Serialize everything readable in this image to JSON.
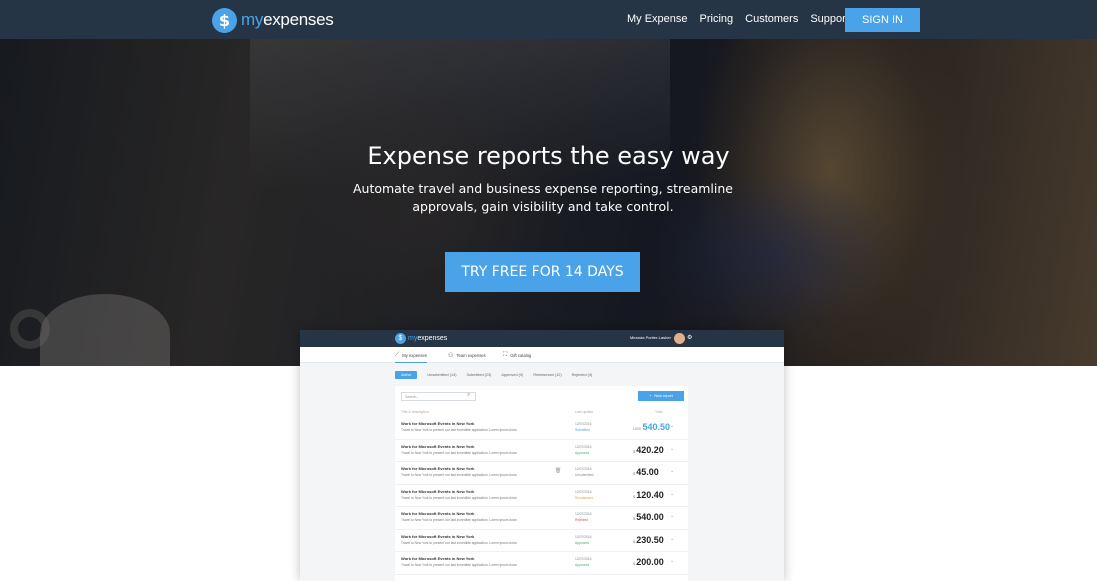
{
  "header": {
    "logo_my": "my",
    "logo_rest": "expenses",
    "logo_symbol": "$",
    "links": [
      "My Expense",
      "Pricing",
      "Customers",
      "Support"
    ],
    "signin_label": "SIGN IN"
  },
  "hero": {
    "title": "Expense reports the easy way",
    "subtitle": "Automate travel and business expense reporting, streamline approvals, gain visibility and take control.",
    "cta_label": "TRY FREE FOR 14 DAYS"
  },
  "colors": {
    "brand_dark": "#263545",
    "accent": "#4aa3e8",
    "approved": "#3cb371",
    "rejected": "#e05050",
    "submitted": "#4aa3e8",
    "unsubmitted": "#888888",
    "reimbursed": "#f0a030"
  },
  "preview": {
    "logo_my": "my",
    "logo_rest": "expenses",
    "user_name": "Miranda Portier-Lasher",
    "tabs": [
      {
        "icon": "chart-icon",
        "label": "My expenses"
      },
      {
        "icon": "team-icon",
        "label": "Team expenses"
      },
      {
        "icon": "gift-icon",
        "label": "Gift catalog"
      }
    ],
    "filters": [
      "Active",
      "Unsubmitted (14)",
      "Submitted (23)",
      "Approved (0)",
      "Reimbursed (12)",
      "Rejected (4)"
    ],
    "search_placeholder": "Search...",
    "new_report_label": "New report",
    "columns": {
      "title": "Title & description",
      "date": "Last update",
      "amount": "Total"
    },
    "rows": [
      {
        "title": "Work for Microsoft Events in New York",
        "desc": "Travel to New York to present our last incredible application. Lorem ipsum dolor.",
        "date": "12/07/2016",
        "status": "Submitted",
        "status_color": "#4aa3e8",
        "currency": "USD",
        "amount": "540.50",
        "highlight": true
      },
      {
        "title": "Work for Microsoft Events in New York",
        "desc": "Travel to New York to present our last incredible application. Lorem ipsum dolor.",
        "date": "12/07/2016",
        "status": "Approved",
        "status_color": "#3cb371",
        "currency": "$",
        "amount": "420.20",
        "highlight": false
      },
      {
        "title": "Work for Microsoft Events in New York",
        "desc": "Travel to New York to present our last incredible application. Lorem ipsum dolor.",
        "date": "12/07/2016",
        "status": "Unsubmitted",
        "status_color": "#888888",
        "currency": "$",
        "amount": "45.00",
        "highlight": false
      },
      {
        "title": "Work for Microsoft Events in New York",
        "desc": "Travel to New York to present our last incredible application. Lorem ipsum dolor.",
        "date": "12/07/2016",
        "status": "Reimbursed",
        "status_color": "#f0a030",
        "currency": "$",
        "amount": "120.40",
        "highlight": false
      },
      {
        "title": "Work for Microsoft Events in New York",
        "desc": "Travel to New York to present our last incredible application. Lorem ipsum dolor.",
        "date": "12/07/2016",
        "status": "Rejected",
        "status_color": "#e05050",
        "currency": "$",
        "amount": "540.00",
        "highlight": false
      },
      {
        "title": "Work for Microsoft Events in New York",
        "desc": "Travel to New York to present our last incredible application. Lorem ipsum dolor.",
        "date": "12/07/2016",
        "status": "Approved",
        "status_color": "#3cb371",
        "currency": "$",
        "amount": "230.50",
        "highlight": false
      },
      {
        "title": "Work for Microsoft Events in New York",
        "desc": "Travel to New York to present our last incredible application. Lorem ipsum dolor.",
        "date": "12/07/2016",
        "status": "Approved",
        "status_color": "#3cb371",
        "currency": "$",
        "amount": "200.00",
        "highlight": false
      }
    ]
  }
}
